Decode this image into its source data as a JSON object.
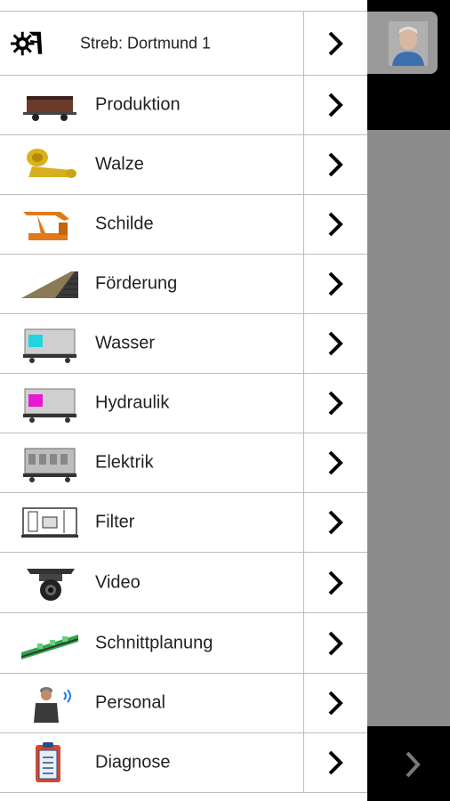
{
  "header": {
    "label": "Streb: Dortmund 1"
  },
  "menu": {
    "items": [
      {
        "label": "Produktion"
      },
      {
        "label": "Walze"
      },
      {
        "label": "Schilde"
      },
      {
        "label": "Förderung"
      },
      {
        "label": "Wasser"
      },
      {
        "label": "Hydraulik"
      },
      {
        "label": "Elektrik"
      },
      {
        "label": "Filter"
      },
      {
        "label": "Video"
      },
      {
        "label": "Schnittplanung"
      },
      {
        "label": "Personal"
      },
      {
        "label": "Diagnose"
      }
    ]
  },
  "colors": {
    "accent_cyan": "#22d4e0",
    "accent_magenta": "#e61ad1",
    "divider": "#bdbdbd",
    "side_gray": "#8c8c8c"
  }
}
